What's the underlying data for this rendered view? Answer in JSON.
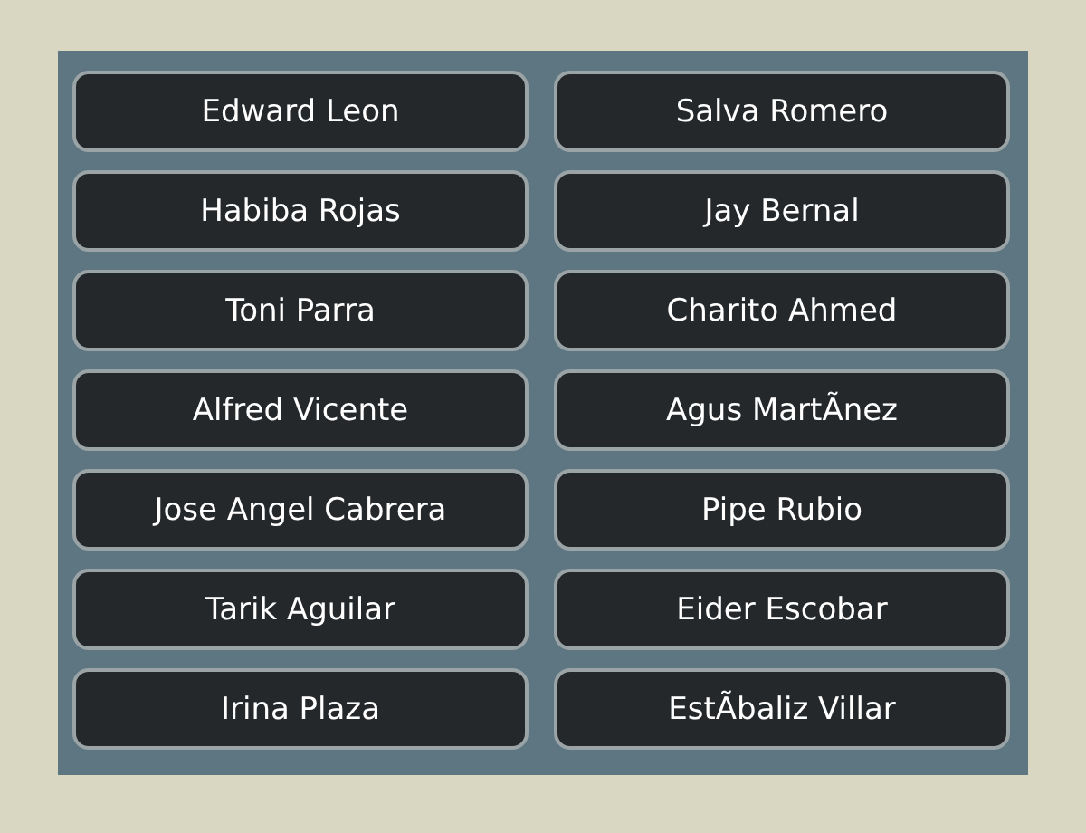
{
  "buttons": [
    {
      "label": "Edward Leon"
    },
    {
      "label": "Salva Romero"
    },
    {
      "label": "Habiba Rojas"
    },
    {
      "label": "Jay Bernal"
    },
    {
      "label": "Toni Parra"
    },
    {
      "label": "Charito Ahmed"
    },
    {
      "label": "Alfred Vicente"
    },
    {
      "label": "Agus MartÃnez"
    },
    {
      "label": "Jose Angel Cabrera"
    },
    {
      "label": "Pipe Rubio"
    },
    {
      "label": "Tarik Aguilar"
    },
    {
      "label": "Eider Escobar"
    },
    {
      "label": "Irina Plaza"
    },
    {
      "label": "EstÃbaliz Villar"
    }
  ]
}
